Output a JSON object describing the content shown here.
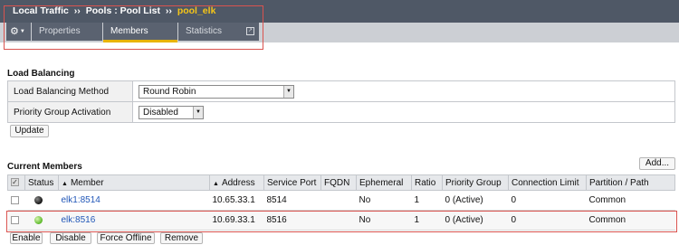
{
  "header": {
    "breadcrumb": {
      "part1": "Local Traffic",
      "sep1": "››",
      "part2": "Pools : Pool List",
      "sep2": "››",
      "current": "pool_elk"
    },
    "gear_icon": "gear-icon",
    "tabs": [
      {
        "label": "Properties"
      },
      {
        "label": "Members"
      },
      {
        "label": "Statistics"
      }
    ],
    "active_tab": "Members",
    "colors": {
      "bar": "#4f5866",
      "current": "#f5c518",
      "active_underline": "#e8b400",
      "highlight_border": "#d9534f"
    }
  },
  "load_balancing": {
    "title": "Load Balancing",
    "method_label": "Load Balancing Method",
    "method_value": "Round Robin",
    "priority_label": "Priority Group Activation",
    "priority_value": "Disabled",
    "update_button": "Update"
  },
  "members": {
    "title": "Current Members",
    "add_button": "Add...",
    "columns": {
      "status": "Status",
      "member": "Member",
      "address": "Address",
      "service_port": "Service Port",
      "fqdn": "FQDN",
      "ephemeral": "Ephemeral",
      "ratio": "Ratio",
      "priority_group": "Priority Group",
      "connection_limit": "Connection Limit",
      "partition_path": "Partition / Path"
    },
    "rows": [
      {
        "status_icon": "black",
        "member": "elk1:8514",
        "address": "10.65.33.1",
        "service_port": "8514",
        "fqdn": "",
        "ephemeral": "No",
        "ratio": "1",
        "priority_group": "0  (Active)",
        "connection_limit": "0",
        "partition_path": "Common"
      },
      {
        "status_icon": "green",
        "member": "elk:8516",
        "address": "10.69.33.1",
        "service_port": "8516",
        "fqdn": "",
        "ephemeral": "No",
        "ratio": "1",
        "priority_group": "0  (Active)",
        "connection_limit": "0",
        "partition_path": "Common"
      }
    ],
    "actions": {
      "enable": "Enable",
      "disable": "Disable",
      "force_offline": "Force Offline",
      "remove": "Remove"
    }
  }
}
